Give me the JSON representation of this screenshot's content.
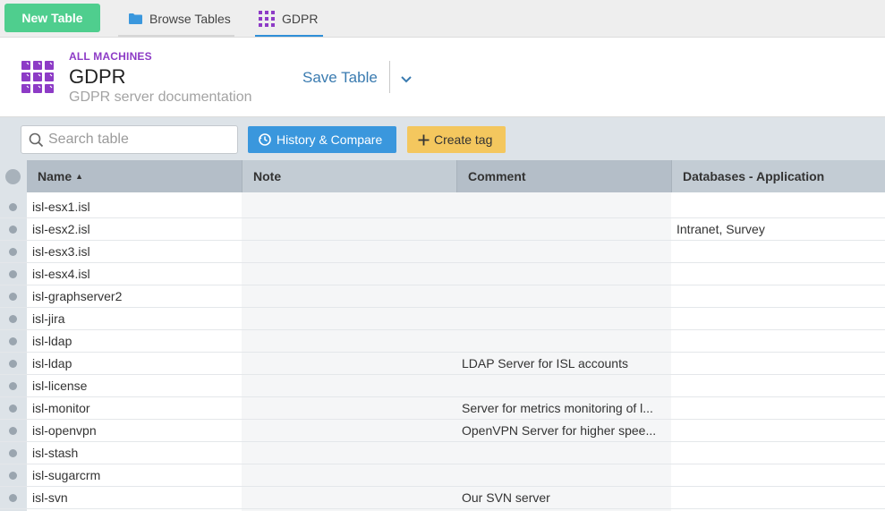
{
  "nav": {
    "new_table": "New Table",
    "browse_tables": "Browse Tables",
    "active_tab": "GDPR"
  },
  "header": {
    "eyebrow": "ALL MACHINES",
    "title": "GDPR",
    "subtitle": "GDPR server documentation",
    "save_label": "Save Table"
  },
  "toolbar": {
    "search_placeholder": "Search table",
    "history_label": "History & Compare",
    "create_tag_label": "Create tag"
  },
  "columns": [
    "Name",
    "Note",
    "Comment",
    "Databases - Application"
  ],
  "sort": {
    "column": "Name",
    "direction": "ascending"
  },
  "rows": [
    {
      "name": "isl-esx1.isl",
      "note": "",
      "comment": "",
      "databases": ""
    },
    {
      "name": "isl-esx2.isl",
      "note": "",
      "comment": "",
      "databases": "Intranet, Survey"
    },
    {
      "name": "isl-esx3.isl",
      "note": "",
      "comment": "",
      "databases": ""
    },
    {
      "name": "isl-esx4.isl",
      "note": "",
      "comment": "",
      "databases": ""
    },
    {
      "name": "isl-graphserver2",
      "note": "",
      "comment": "",
      "databases": ""
    },
    {
      "name": "isl-jira",
      "note": "",
      "comment": "",
      "databases": ""
    },
    {
      "name": "isl-ldap",
      "note": "",
      "comment": "",
      "databases": ""
    },
    {
      "name": "isl-ldap",
      "note": "",
      "comment": "LDAP Server for ISL accounts",
      "databases": ""
    },
    {
      "name": "isl-license",
      "note": "",
      "comment": "",
      "databases": ""
    },
    {
      "name": "isl-monitor",
      "note": "",
      "comment": "Server for metrics monitoring of l...",
      "databases": ""
    },
    {
      "name": "isl-openvpn",
      "note": "",
      "comment": "OpenVPN Server for higher spee...",
      "databases": ""
    },
    {
      "name": "isl-stash",
      "note": "",
      "comment": "",
      "databases": ""
    },
    {
      "name": "isl-sugarcrm",
      "note": "",
      "comment": "",
      "databases": ""
    },
    {
      "name": "isl-svn",
      "note": "",
      "comment": "Our SVN server",
      "databases": ""
    }
  ],
  "colors": {
    "new_table": "#4fce8e",
    "accent_blue": "#3a97dd",
    "tag_yellow": "#f4c75e",
    "brand_purple": "#8d3bc6"
  }
}
